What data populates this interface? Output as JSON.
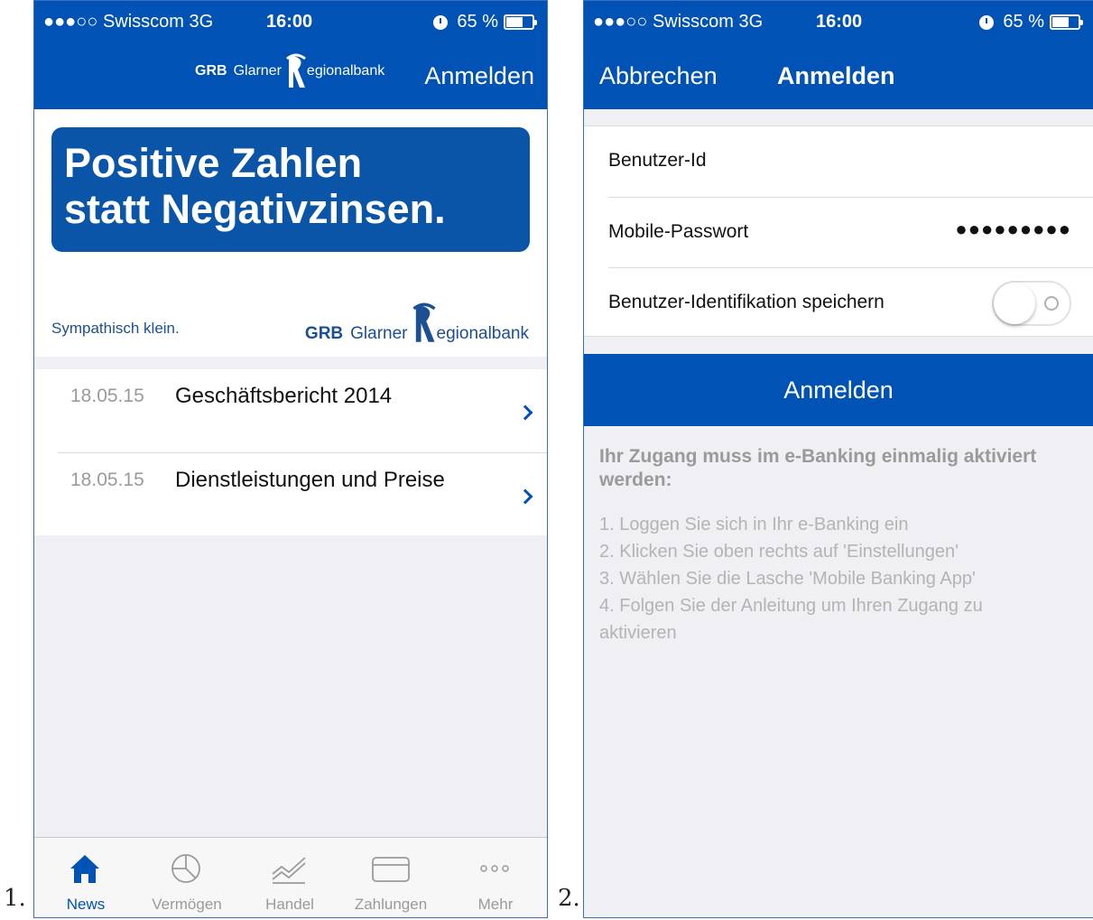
{
  "labels": {
    "first": "1.",
    "second": "2."
  },
  "status_bar": {
    "carrier": "●●●○○ Swisscom  3G",
    "time": "16:00",
    "battery": "65 %",
    "battery_level": 0.65,
    "icons": [
      "alarm-icon",
      "battery-icon"
    ]
  },
  "screen1": {
    "nav": {
      "logo_grb": "GRB",
      "logo_glarner": "Glarner",
      "logo_rest": "egionalbank",
      "login_label": "Anmelden"
    },
    "banner": {
      "line1": "Positive Zahlen",
      "line2": "statt Negativzinsen.",
      "slogan": "Sympathisch klein.",
      "logo_grb": "GRB",
      "logo_glarner": "Glarner",
      "logo_rest": "egionalbank"
    },
    "news": [
      {
        "date": "18.05.15",
        "title": "Geschäftsbericht 2014"
      },
      {
        "date": "18.05.15",
        "title": "Dienstleistungen und Preise"
      }
    ],
    "tabs": [
      {
        "label": "News",
        "icon": "home-icon",
        "active": true
      },
      {
        "label": "Vermögen",
        "icon": "pie-chart-icon",
        "active": false
      },
      {
        "label": "Handel",
        "icon": "trend-icon",
        "active": false
      },
      {
        "label": "Zahlungen",
        "icon": "card-icon",
        "active": false
      },
      {
        "label": "Mehr",
        "icon": "more-icon",
        "active": false
      }
    ],
    "colors": {
      "brand": "#0052b4",
      "banner": "#0a55a8",
      "tab_inactive": "#9a9a9a"
    }
  },
  "screen2": {
    "nav": {
      "cancel": "Abbrechen",
      "title": "Anmelden"
    },
    "form": {
      "user_id_label": "Benutzer-Id",
      "user_id_value": "",
      "password_label": "Mobile-Passwort",
      "password_value": "●●●●●●●●●",
      "save_label": "Benutzer-Identifikation speichern",
      "save_enabled": false
    },
    "login_button": "Anmelden",
    "info_heading": "Ihr Zugang muss im e-Banking einmalig aktiviert werden:",
    "info_steps": [
      "1. Loggen Sie sich in Ihr e-Banking ein",
      "2. Klicken Sie oben rechts auf 'Einstellungen'",
      "3. Wählen Sie die Lasche 'Mobile Banking App'",
      "4. Folgen Sie der Anleitung um Ihren Zugang zu aktivieren"
    ]
  }
}
